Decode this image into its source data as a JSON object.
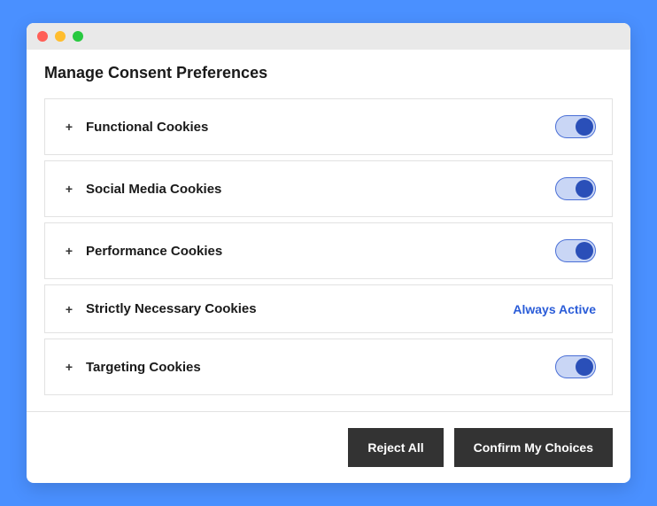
{
  "header": {
    "title": "Manage Consent Preferences"
  },
  "categories": [
    {
      "label": "Functional Cookies",
      "control": "toggle",
      "enabled": true
    },
    {
      "label": "Social Media Cookies",
      "control": "toggle",
      "enabled": true
    },
    {
      "label": "Performance Cookies",
      "control": "toggle",
      "enabled": true
    },
    {
      "label": "Strictly Necessary Cookies",
      "control": "always",
      "status_text": "Always Active"
    },
    {
      "label": "Targeting Cookies",
      "control": "toggle",
      "enabled": true
    }
  ],
  "footer": {
    "reject_label": "Reject All",
    "confirm_label": "Confirm My Choices"
  },
  "icons": {
    "expand": "+"
  }
}
